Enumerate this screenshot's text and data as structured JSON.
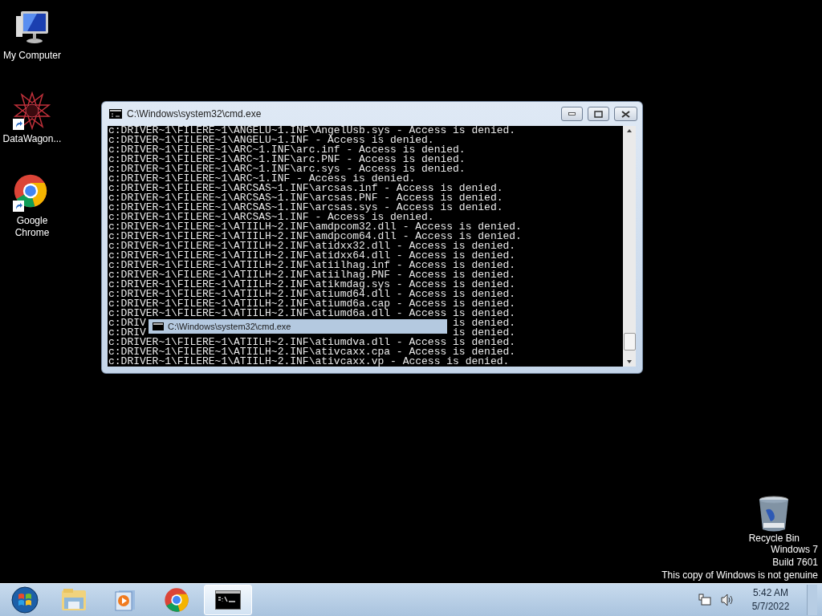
{
  "desktop_icons": [
    {
      "kind": "computer",
      "label": "My Computer",
      "shortcut": false
    },
    {
      "kind": "star",
      "label": "DataWagon...",
      "shortcut": true
    },
    {
      "kind": "chrome",
      "label": "Google Chrome",
      "shortcut": true
    }
  ],
  "window": {
    "title": "C:\\Windows\\system32\\cmd.exe",
    "lines": [
      {
        "text": "c:DRIVER~1\\FILERE~1\\ANGELU~1.INF\\AngelUsb.sys - Access is denied."
      },
      {
        "text": "c:DRIVER~1\\FILERE~1\\ANGELU~1.INF - Access is denied."
      },
      {
        "text": "c:DRIVER~1\\FILERE~1\\ARC~1.INF\\arc.inf - Access is denied."
      },
      {
        "text": "c:DRIVER~1\\FILERE~1\\ARC~1.INF\\arc.PNF - Access is denied."
      },
      {
        "text": "c:DRIVER~1\\FILERE~1\\ARC~1.INF\\arc.sys - Access is denied."
      },
      {
        "text": "c:DRIVER~1\\FILERE~1\\ARC~1.INF - Access is denied."
      },
      {
        "text": "c:DRIVER~1\\FILERE~1\\ARCSAS~1.INF\\arcsas.inf - Access is denied."
      },
      {
        "text": "c:DRIVER~1\\FILERE~1\\ARCSAS~1.INF\\arcsas.PNF - Access is denied."
      },
      {
        "text": "c:DRIVER~1\\FILERE~1\\ARCSAS~1.INF\\arcsas.sys - Access is denied."
      },
      {
        "text": "c:DRIVER~1\\FILERE~1\\ARCSAS~1.INF - Access is denied."
      },
      {
        "text": "c:DRIVER~1\\FILERE~1\\ATIILH~2.INF\\amdpcom32.dll - Access is denied."
      },
      {
        "text": "c:DRIVER~1\\FILERE~1\\ATIILH~2.INF\\amdpcom64.dll - Access is denied."
      },
      {
        "text": "c:DRIVER~1\\FILERE~1\\ATIILH~2.INF\\atidxx32.dll - Access is denied."
      },
      {
        "text": "c:DRIVER~1\\FILERE~1\\ATIILH~2.INF\\atidxx64.dll - Access is denied."
      },
      {
        "text": "c:DRIVER~1\\FILERE~1\\ATIILH~2.INF\\atiilhag.inf - Access is denied."
      },
      {
        "text": "c:DRIVER~1\\FILERE~1\\ATIILH~2.INF\\atiilhag.PNF - Access is denied."
      },
      {
        "text": "c:DRIVER~1\\FILERE~1\\ATIILH~2.INF\\atikmdag.sys - Access is denied."
      },
      {
        "text": "c:DRIVER~1\\FILERE~1\\ATIILH~2.INF\\atiumd64.dll - Access is denied."
      },
      {
        "text": "c:DRIVER~1\\FILERE~1\\ATIILH~2.INF\\atiumd6a.cap - Access is denied."
      },
      {
        "text": "c:DRIVER~1\\FILERE~1\\ATIILH~2.INF\\atiumd6a.dll - Access is denied."
      },
      {
        "start": "c:DRIV",
        "end": "is denied."
      },
      {
        "start": "c:DRIV",
        "end": "is denied."
      },
      {
        "text": "c:DRIVER~1\\FILERE~1\\ATIILH~2.INF\\atiumdva.dll - Access is denied."
      },
      {
        "text": "c:DRIVER~1\\FILERE~1\\ATIILH~2.INF\\ativcaxx.cpa - Access is denied."
      },
      {
        "text": "c:DRIVER~1\\FILERE~1\\ATIILH~2.INF\\ativcaxx.vp - Access is denied."
      }
    ],
    "drag_ghost": {
      "title": "C:\\Windows\\system32\\cmd.exe"
    }
  },
  "recycle_bin": {
    "label": "Recycle Bin"
  },
  "notice": [
    "Windows 7",
    "Build 7601",
    "This copy of Windows is not genuine"
  ],
  "taskbar": {
    "items": [
      {
        "kind": "start",
        "selected": false
      },
      {
        "kind": "folder",
        "selected": false
      },
      {
        "kind": "media",
        "selected": false
      },
      {
        "kind": "chrome",
        "selected": false
      },
      {
        "kind": "cmd",
        "selected": true
      }
    ],
    "clock": {
      "time": "5:42 AM",
      "date": "5/7/2022"
    }
  }
}
